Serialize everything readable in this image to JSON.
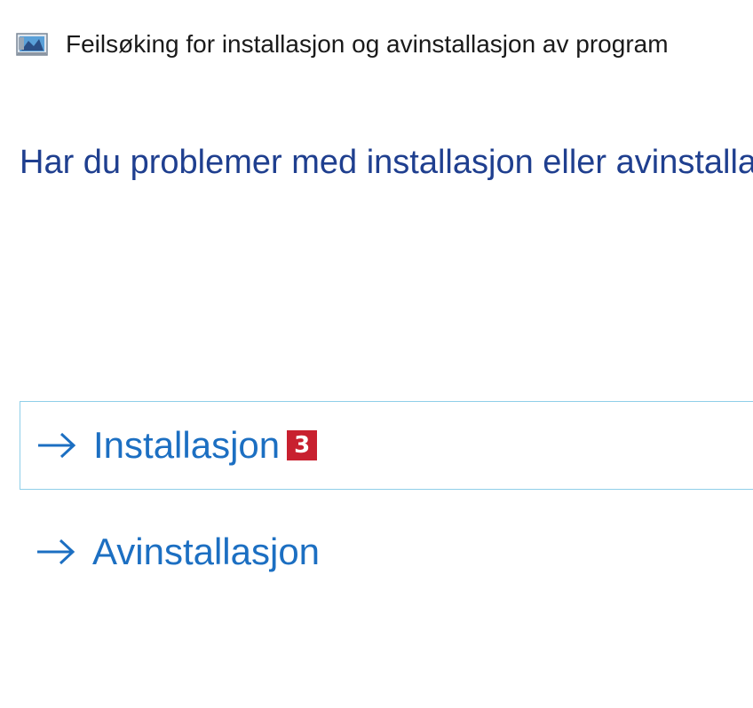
{
  "window": {
    "title": "Feilsøking for installasjon og avinstallasjon av program",
    "icon": "troubleshooter-app-icon"
  },
  "main": {
    "heading": "Har du problemer med installasjon eller avinstallasjon av et program?",
    "options": [
      {
        "label": "Installasjon",
        "icon": "arrow-right-icon",
        "selected": true,
        "badge": "3"
      },
      {
        "label": "Avinstallasjon",
        "icon": "arrow-right-icon",
        "selected": false
      }
    ]
  },
  "colors": {
    "heading": "#1f3f8f",
    "link": "#1c6fc2",
    "selection_border": "#8fcfe9",
    "badge_bg": "#c8202f"
  }
}
